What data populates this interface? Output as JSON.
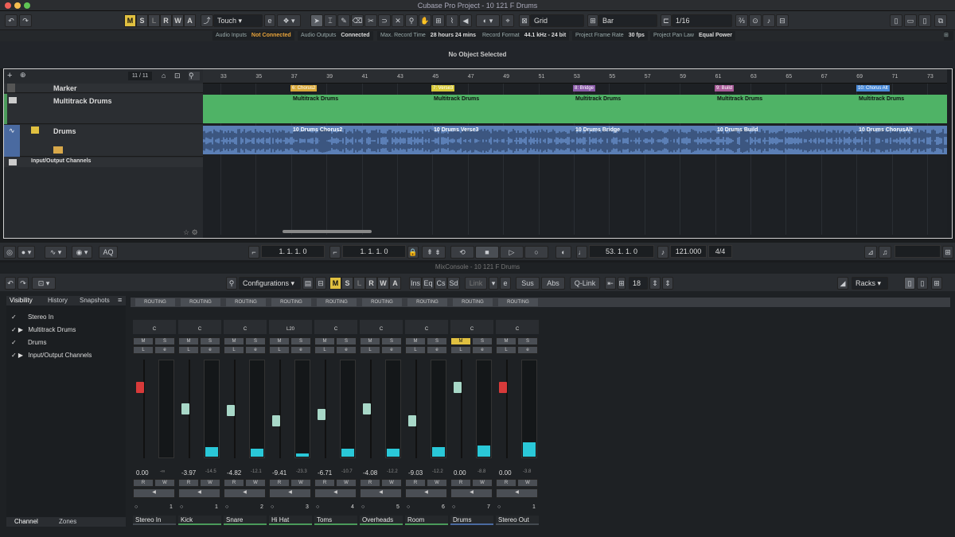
{
  "window": {
    "title": "Cubase Pro Project - 10 121 F Drums"
  },
  "toolbar": {
    "modes": [
      "M",
      "S",
      "L",
      "R",
      "W",
      "A"
    ],
    "automation_mode": "Touch",
    "snap_type": "Grid",
    "grid": "Bar",
    "quantize": "1/16"
  },
  "status": [
    {
      "label": "Audio Inputs",
      "value": "Not Connected",
      "color": "#e8a33a"
    },
    {
      "label": "Audio Outputs",
      "value": "Connected",
      "color": "#dddddd"
    },
    {
      "label": "Max. Record Time",
      "value": "28 hours 24 mins",
      "color": "#dddddd"
    },
    {
      "label": "Record Format",
      "value": "44.1 kHz - 24 bit",
      "color": "#dddddd"
    },
    {
      "label": "Project Frame Rate",
      "value": "30 fps",
      "color": "#dddddd"
    },
    {
      "label": "Project Pan Law",
      "value": "Equal Power",
      "color": "#dddddd"
    }
  ],
  "info_line": "No Object Selected",
  "project": {
    "track_count": "11 / 11",
    "tracks": [
      "Marker",
      "Multitrack Drums",
      "Drums",
      "Input/Output Channels"
    ],
    "ruler": [
      "33",
      "35",
      "37",
      "39",
      "41",
      "43",
      "45",
      "47",
      "49",
      "51",
      "53",
      "55",
      "57",
      "59",
      "61",
      "63",
      "65",
      "67",
      "69",
      "71",
      "73"
    ],
    "markers": [
      {
        "label": "6: Chorus2",
        "color": "#d8a83a"
      },
      {
        "label": "7: Verse3",
        "color": "#d8c93a"
      },
      {
        "label": "8: Bridge",
        "color": "#8a5aa8"
      },
      {
        "label": "9: Build",
        "color": "#a85a98"
      },
      {
        "label": "10: Chorus Alt",
        "color": "#4a8ad8"
      }
    ],
    "folder_events": [
      "Multitrack Drums",
      "Multitrack Drums",
      "Multitrack Drums",
      "Multitrack Drums",
      "Multitrack Drums"
    ],
    "audio_events": [
      "10 Drums Chorus2",
      "10 Drums Verse3",
      "10 Drums Bridge",
      "10 Drums Build",
      "10 Drums ChorusAlt"
    ]
  },
  "transport": {
    "left_locator": "1. 1. 1. 0",
    "right_locator": "1. 1. 1. 0",
    "position": "53. 1. 1. 0",
    "tempo": "121.000",
    "signature": "4/4",
    "aq": "AQ"
  },
  "mixer": {
    "title": "MixConsole - 10 121 F Drums",
    "configurations": "Configurations",
    "link": "Link",
    "sus": "Sus",
    "abs": "Abs",
    "qlink": "Q-Link",
    "channel_count": "18",
    "racks": "Racks",
    "tabs": [
      "Ins",
      "Eq",
      "Cs",
      "Sd"
    ],
    "visibility_tabs": [
      "Visibility",
      "History",
      "Snapshots"
    ],
    "visibility_items": [
      "Stereo In",
      "Multitrack Drums",
      "Drums",
      "Input/Output Channels"
    ],
    "bottom_tabs": [
      "Channel",
      "Zones"
    ],
    "routing_label": "ROUTING",
    "channels": [
      {
        "name": "Stereo In",
        "pan": "C",
        "vol": "0.00",
        "peak": "-∞",
        "num": "1",
        "color": "#444a50",
        "meter": 0,
        "fader": 0.28
      },
      {
        "name": "Kick",
        "pan": "C",
        "vol": "-3.97",
        "peak": "-14.5",
        "num": "1",
        "color": "#4a9a5a",
        "meter": 0.1,
        "fader": 0.5
      },
      {
        "name": "Snare",
        "pan": "C",
        "vol": "-4.82",
        "peak": "-12.1",
        "num": "2",
        "color": "#4a9a5a",
        "meter": 0.08,
        "fader": 0.52
      },
      {
        "name": "Hi Hat",
        "pan": "L20",
        "vol": "-9.41",
        "peak": "-23.3",
        "num": "3",
        "color": "#4a9a5a",
        "meter": 0.03,
        "fader": 0.62
      },
      {
        "name": "Toms",
        "pan": "C",
        "vol": "-6.71",
        "peak": "-10.7",
        "num": "4",
        "color": "#4a9a5a",
        "meter": 0.08,
        "fader": 0.56
      },
      {
        "name": "Overheads",
        "pan": "C",
        "vol": "-4.08",
        "peak": "-12.2",
        "num": "5",
        "color": "#4a9a5a",
        "meter": 0.08,
        "fader": 0.5
      },
      {
        "name": "Room",
        "pan": "C",
        "vol": "-9.03",
        "peak": "-12.2",
        "num": "6",
        "color": "#4a9a5a",
        "meter": 0.1,
        "fader": 0.62
      },
      {
        "name": "Drums",
        "pan": "C",
        "vol": "0.00",
        "peak": "-8.8",
        "num": "7",
        "color": "#4a6aa0",
        "meter": 0.12,
        "fader": 0.28
      },
      {
        "name": "Stereo Out",
        "pan": "C",
        "vol": "0.00",
        "peak": "-3.8",
        "num": "1",
        "color": "#444a50",
        "meter": 0.15,
        "fader": 0.28
      }
    ],
    "scale": [
      "+6",
      "+4",
      "0",
      "5",
      "10",
      "15",
      "20",
      "25",
      "30",
      "35",
      "40",
      "45",
      "50",
      "60",
      "∞"
    ]
  }
}
